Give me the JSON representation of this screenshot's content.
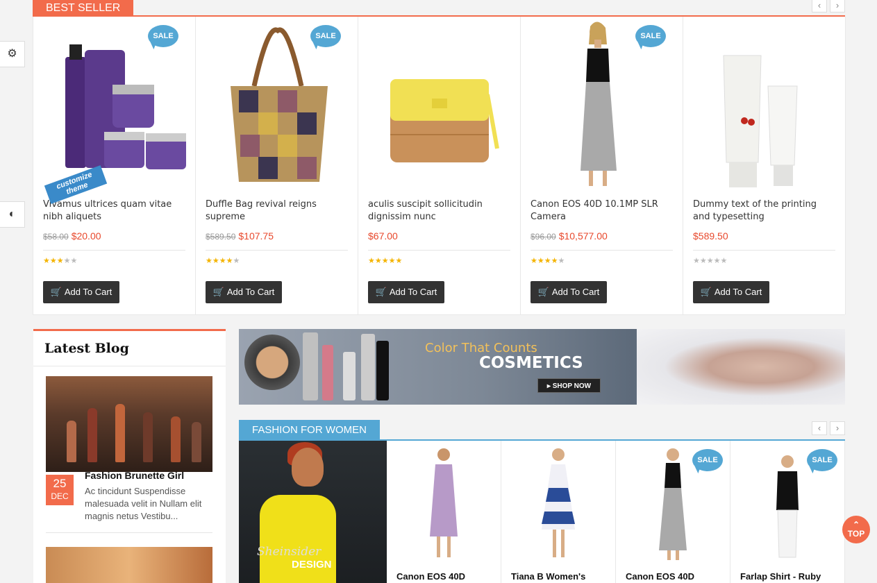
{
  "best_seller": {
    "title": "BEST SELLER",
    "prev_label": "‹",
    "next_label": "›",
    "products": [
      {
        "name": "Vivamus ultrices quam vitae nibh aliquets",
        "old_price": "$58.00",
        "price": "$20.00",
        "sale": "SALE",
        "rating": 3,
        "cart_label": "Add To Cart"
      },
      {
        "name": "Duffle Bag revival reigns supreme",
        "old_price": "$589.50",
        "price": "$107.75",
        "sale": "SALE",
        "rating": 4,
        "cart_label": "Add To Cart"
      },
      {
        "name": "aculis suscipit sollicitudin dignissim nunc",
        "old_price": "",
        "price": "$67.00",
        "sale": "",
        "rating": 5,
        "cart_label": "Add To Cart"
      },
      {
        "name": "Canon EOS 40D 10.1MP SLR Camera",
        "old_price": "$96.00",
        "price": "$10,577.00",
        "sale": "SALE",
        "rating": 4,
        "cart_label": "Add To Cart"
      },
      {
        "name": "Dummy text of the printing and typesetting",
        "old_price": "",
        "price": "$589.50",
        "sale": "",
        "rating": 0,
        "cart_label": "Add To Cart"
      }
    ]
  },
  "customize_badge": "customize theme",
  "latest_blog": {
    "title": "Latest Blog",
    "post": {
      "day": "25",
      "month": "DEC",
      "title": "Fashion Brunette Girl",
      "excerpt": "Ac tincidunt Suspendisse malesuada velit in Nullam elit magnis netus Vestibu..."
    }
  },
  "cosmetics_banner": {
    "tagline": "Color That Counts",
    "headline": "COSMETICS",
    "cta": "SHOP NOW"
  },
  "fashion_women": {
    "title": "FASHION FOR WOMEN",
    "prev_label": "‹",
    "next_label": "›",
    "banner_text1": "Sheinsider",
    "banner_text2": "DESIGN",
    "products": [
      {
        "name": "Canon EOS 40D",
        "sale": ""
      },
      {
        "name": "Tiana B Women's",
        "sale": ""
      },
      {
        "name": "Canon EOS 40D",
        "sale": "SALE"
      },
      {
        "name": "Farlap Shirt - Ruby",
        "sale": "SALE"
      }
    ]
  },
  "top_button": "TOP",
  "colors": {
    "accent": "#f26b4b",
    "secondary": "#54a7d4",
    "dark": "#333333"
  }
}
